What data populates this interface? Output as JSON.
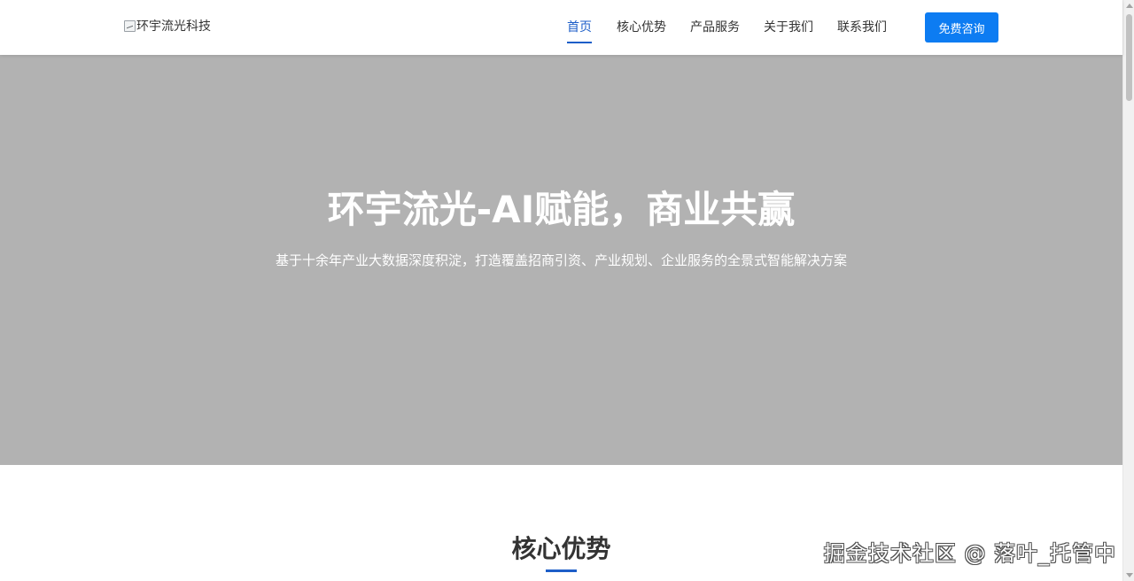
{
  "header": {
    "logo_alt": "环宇流光科技",
    "nav": [
      {
        "label": "首页",
        "active": true
      },
      {
        "label": "核心优势",
        "active": false
      },
      {
        "label": "产品服务",
        "active": false
      },
      {
        "label": "关于我们",
        "active": false
      },
      {
        "label": "联系我们",
        "active": false
      }
    ],
    "cta_label": "免费咨询"
  },
  "hero": {
    "title": "环宇流光-AI赋能，商业共赢",
    "subtitle": "基于十余年产业大数据深度积淀，打造覆盖招商引资、产业规划、企业服务的全景式智能解决方案"
  },
  "section": {
    "title": "核心优势"
  },
  "watermark": "掘金技术社区 @ 落叶_托管中",
  "colors": {
    "accent": "#1d5ec8",
    "cta": "#0d7cf2",
    "hero_bg": "#b2b2b2"
  }
}
